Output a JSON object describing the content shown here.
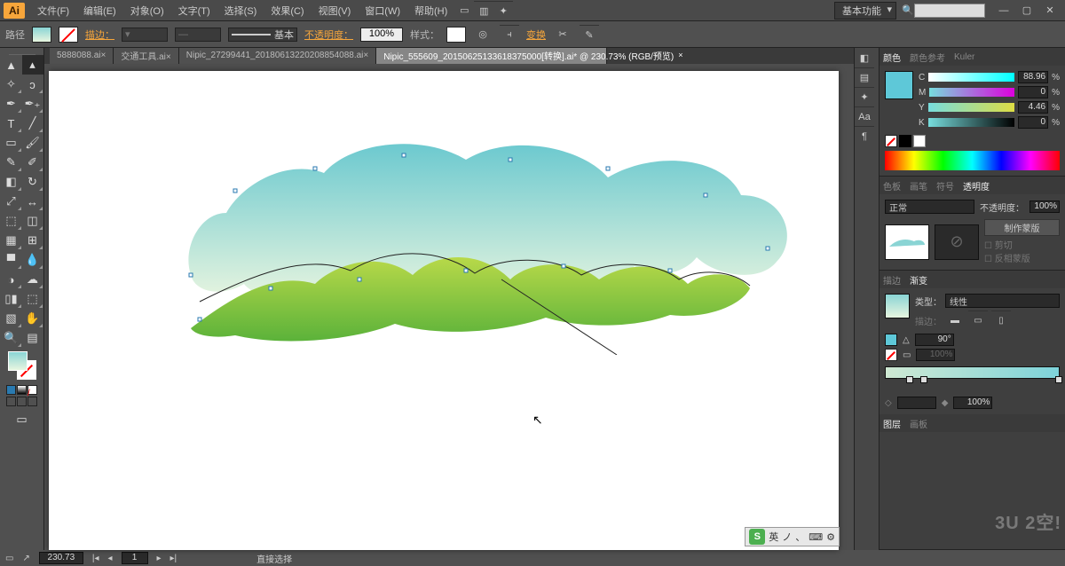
{
  "menu": {
    "items": [
      "文件(F)",
      "编辑(E)",
      "对象(O)",
      "文字(T)",
      "选择(S)",
      "效果(C)",
      "视图(V)",
      "窗口(W)",
      "帮助(H)"
    ],
    "workspace": "基本功能"
  },
  "control": {
    "path_mode": "路径",
    "stroke_label": "描边：",
    "brush": "基本",
    "opacity_label": "不透明度：",
    "opacity": "100%",
    "style_label": "样式：",
    "transform": "变换"
  },
  "tabs": [
    {
      "label": "5888088.ai×",
      "active": false
    },
    {
      "label": "交通工具.ai×",
      "active": false
    },
    {
      "label": "Nipic_27299441_20180613220208854088.ai×",
      "active": false
    },
    {
      "label": "Nipic_555609_20150625133618375000[转换].ai* @ 230.73% (RGB/预览)",
      "active": true
    }
  ],
  "color": {
    "tab1": "颜色",
    "tab2": "颜色参考",
    "tab3": "Kuler",
    "c": "88.96",
    "m": "0",
    "y": "4.46",
    "k": "0",
    "pct": "%"
  },
  "swatch_tabs": [
    "色板",
    "画笔",
    "符号",
    "透明度"
  ],
  "trans": {
    "blend": "正常",
    "op_label": "不透明度：",
    "op": "100%",
    "make_mask": "制作蒙版",
    "clip": "剪切",
    "invert": "反相蒙版"
  },
  "grad": {
    "tab_stroke": "描边",
    "tab_grad": "渐变",
    "type_label": "类型：",
    "type": "线性",
    "stroke_label": "描边：",
    "angle": "90°",
    "ar": "100%",
    "pos": "100%"
  },
  "layers": {
    "tab1": "图层",
    "tab2": "画板"
  },
  "footer": {
    "zoom": "230.73",
    "page": "1",
    "nav": "1",
    "tool": "直接选择"
  },
  "ime": {
    "s": "S",
    "lang": "英",
    "half": "ノ",
    "punc": "、"
  }
}
